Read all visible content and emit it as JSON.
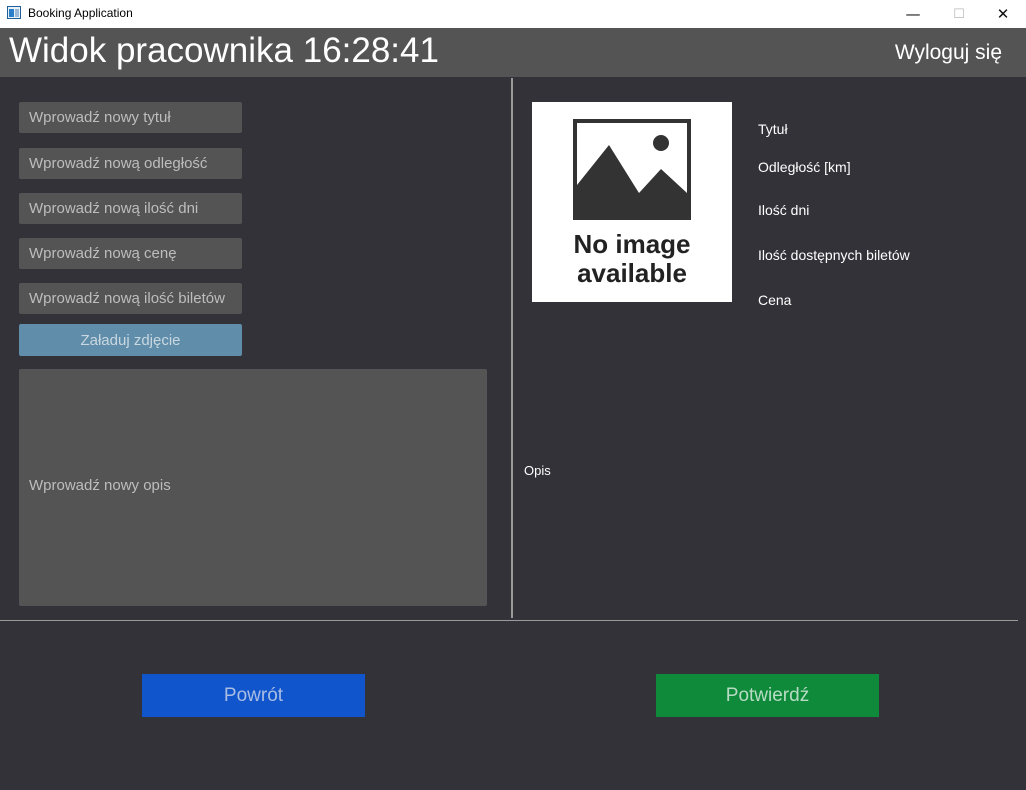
{
  "window": {
    "title": "Booking Application",
    "minimize_glyph": "—",
    "maximize_glyph": "☐",
    "close_glyph": "✕"
  },
  "header": {
    "title": "Widok pracownika 16:28:41",
    "logout_label": "Wyloguj się"
  },
  "form": {
    "title_placeholder": "Wprowadź nowy tytuł",
    "distance_placeholder": "Wprowadź nową odległość",
    "days_placeholder": "Wprowadź nową ilość dni",
    "price_placeholder": "Wprowadź nową cenę",
    "tickets_placeholder": "Wprowadź nową ilość biletów",
    "upload_label": "Załaduj zdjęcie",
    "description_placeholder": "Wprowadź nowy opis"
  },
  "preview": {
    "image_text_line1": "No image",
    "image_text_line2": "available",
    "title_label": "Tytuł",
    "distance_label": "Odległość [km]",
    "days_label": "Ilość dni",
    "tickets_label": "Ilość dostępnych biletów",
    "price_label": "Cena",
    "description_label": "Opis"
  },
  "actions": {
    "back_label": "Powrót",
    "confirm_label": "Potwierdź"
  },
  "colors": {
    "background": "#333238",
    "header": "#545454",
    "field": "#545454",
    "upload": "#5f8daa",
    "back": "#1155cc",
    "confirm": "#0f8a3a"
  }
}
